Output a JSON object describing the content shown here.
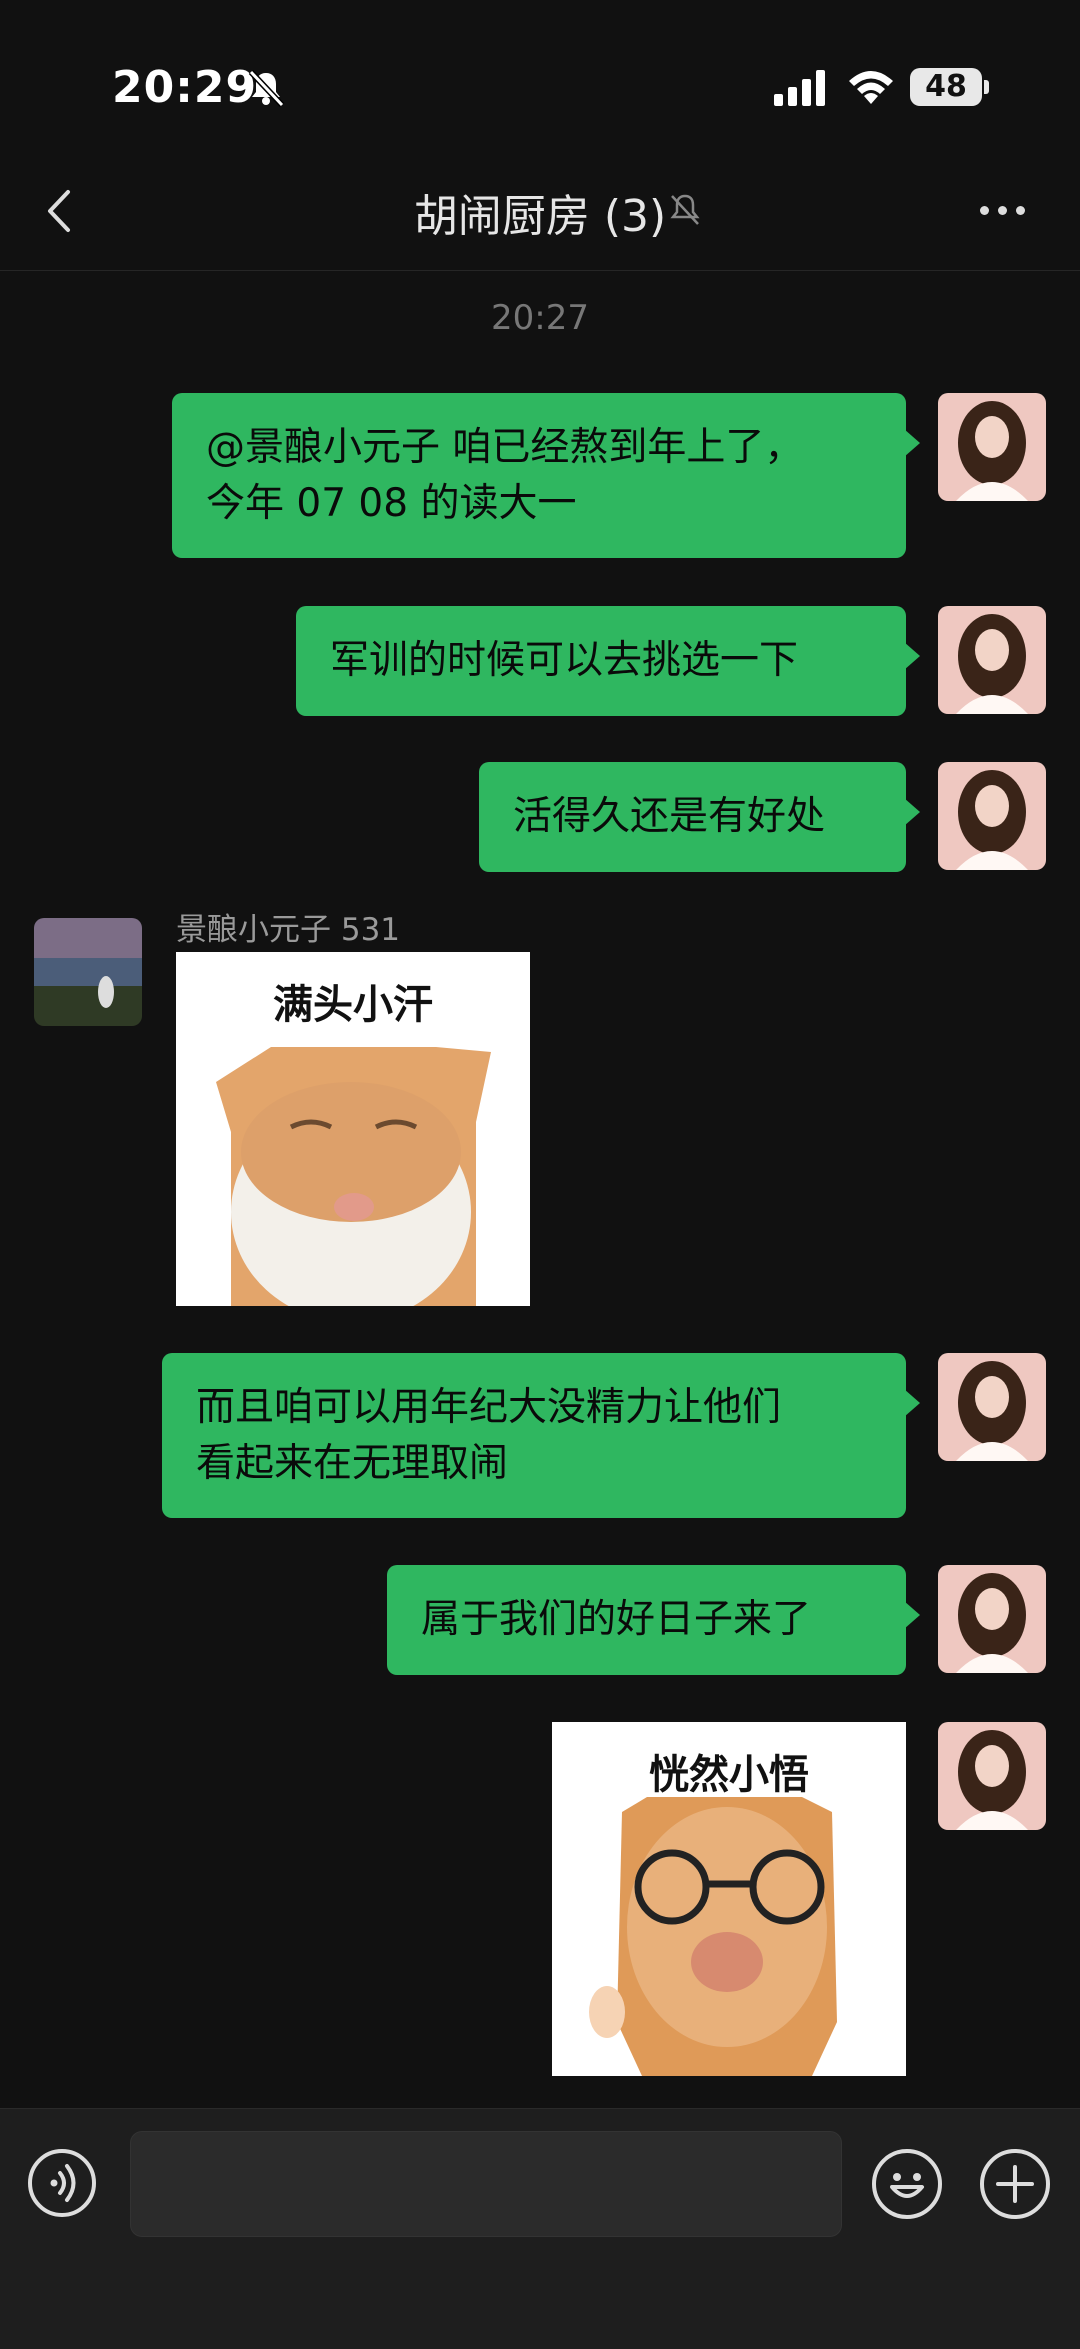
{
  "status_bar": {
    "time": "20:29",
    "battery": "48"
  },
  "header": {
    "title": "胡闹厨房 (3)"
  },
  "timestamp": "20:27",
  "messages": [
    {
      "text_line1": "@景酿小元子 咱已经熬到年上了，",
      "text_line2": "今年 07 08 的读大一"
    },
    {
      "text": "军训的时候可以去挑选一下"
    },
    {
      "text": "活得久还是有好处"
    },
    {
      "sender": "景酿小元子 531",
      "sticker_caption": "满头小汗"
    },
    {
      "text_line1": "而且咱可以用年纪大没精力让他们",
      "text_line2": "看起来在无理取闹"
    },
    {
      "text": "属于我们的好日子来了"
    },
    {
      "sticker_caption": "恍然小悟"
    }
  ],
  "input": {
    "placeholder": ""
  },
  "colors": {
    "bubble": "#2fb760",
    "background": "#111111",
    "input_bar": "#1e1e1e"
  }
}
